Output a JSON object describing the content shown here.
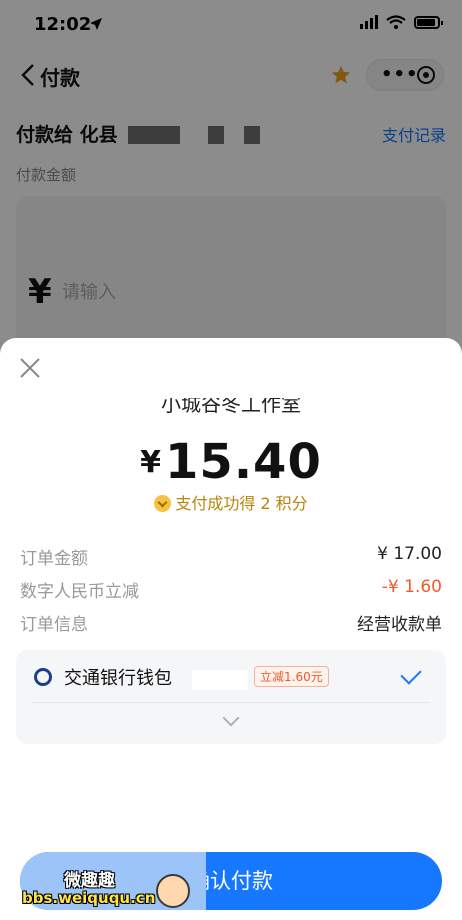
{
  "status_bar": {
    "time": "12:02"
  },
  "nav": {
    "title": "付款"
  },
  "page": {
    "payee_label": "付款给 化县",
    "history_link": "支付记录",
    "amount_label": "付款金额",
    "currency_symbol": "¥",
    "amount_placeholder": "请输入"
  },
  "sheet": {
    "merchant_name": "小城谷冬工作室",
    "currency_symbol": "¥",
    "amount": "15.40",
    "points_text": "支付成功得 2 积分",
    "details": [
      {
        "label": "订单金额",
        "value": "¥ 17.00"
      },
      {
        "label": "数字人民币立减",
        "value": "-¥ 1.60"
      },
      {
        "label": "订单信息",
        "value": "经营收款单"
      }
    ],
    "payment_method": {
      "name": "交通银行钱包",
      "discount_tag": "立减1.60元"
    },
    "confirm_button": "确认付款"
  },
  "watermark": {
    "title": "微趣趣",
    "url": "bbs.weiququ.cn"
  },
  "colors": {
    "accent": "#1677ff",
    "discount": "#f2582a",
    "star": "#f0a020"
  }
}
